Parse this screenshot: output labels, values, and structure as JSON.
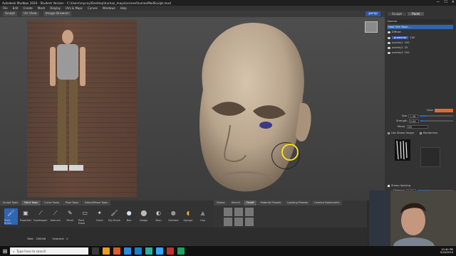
{
  "window": {
    "title": "Autodesk Mudbox 2020 - Student Version - C:\\Users\\mycoy\\Desktop\\human_maya\\scenes\\humanModSculpt.mud",
    "min": "—",
    "max": "☐",
    "close": "✕"
  },
  "menu": [
    "File",
    "Edit",
    "Create",
    "Mesh",
    "Display",
    "UVs & Maps",
    "Curves",
    "Windows",
    "Help"
  ],
  "toolbar": {
    "items": [
      "Sculpt",
      "UV View",
      "Image Browser"
    ],
    "camera": "persp"
  },
  "right_panel": {
    "tabs": [
      "Sculpt",
      "Paint"
    ],
    "dropdown": "Normal",
    "layers": [
      {
        "name": "Head Skin Base ...",
        "selected": true
      },
      {
        "name": "Diffuse",
        "selected": false
      },
      {
        "name": "gradiente",
        "value": "100",
        "selected": true
      },
      {
        "name": "overlay1",
        "value": "100",
        "selected": false
      },
      {
        "name": "overlay2",
        "value": "25",
        "selected": false
      },
      {
        "name": "overlay3",
        "value": "100",
        "selected": false
      }
    ],
    "props": {
      "color_label": "Color",
      "color_hex": "#e36b2a",
      "size_label": "Size",
      "size_value": "1.36",
      "size_fill": 0.2,
      "strength_label": "Strength",
      "strength_value": "0.06",
      "strength_fill": 0.1,
      "mirror_label": "Mirror",
      "mirror_value": "Off",
      "stamp_label": "Use Stamp Image",
      "randomize_label": "Randomize",
      "stamp_spacing_label": "Stamp Spacing",
      "distance_label": "Distance",
      "distance_value": "6.28"
    }
  },
  "trays": {
    "tabs": [
      "Sculpt Tools",
      "Paint Tools",
      "Curve Tools",
      "Pose Tools",
      "Select/Move Tools"
    ],
    "active_tab": "Paint Tools",
    "tools": [
      {
        "label": "Paint Brush",
        "icon": "paint-brush-icon",
        "glyph": "🖌"
      },
      {
        "label": "Projection",
        "icon": "projection-icon",
        "glyph": "▣"
      },
      {
        "label": "Eyedropper",
        "icon": "eyedropper-icon",
        "glyph": "⟋"
      },
      {
        "label": "Airbrush",
        "icon": "airbrush-icon",
        "glyph": "⟋"
      },
      {
        "label": "Pencil",
        "icon": "pencil-icon",
        "glyph": "✎"
      },
      {
        "label": "Paint Erase",
        "icon": "eraser-icon",
        "glyph": "▭"
      },
      {
        "label": "Clone",
        "icon": "clone-icon",
        "glyph": "✦"
      },
      {
        "label": "Dry Brush",
        "icon": "dry-brush-icon",
        "glyph": "🖌"
      },
      {
        "label": "Blur",
        "icon": "blur-icon",
        "glyph": "●"
      },
      {
        "label": "Dodge",
        "icon": "dodge-icon",
        "glyph": "⬤"
      },
      {
        "label": "Burn",
        "icon": "burn-icon",
        "glyph": "◐"
      },
      {
        "label": "Contrast",
        "icon": "contrast-icon",
        "glyph": "●"
      },
      {
        "label": "Sponge",
        "icon": "sponge-icon",
        "glyph": "◖"
      },
      {
        "label": "Hue",
        "icon": "hue-icon",
        "glyph": "▲"
      }
    ]
  },
  "stamps": {
    "tabs": [
      "Stamp",
      "Stencil",
      "Falloff",
      "Material Presets",
      "Lighting Presets",
      "Camera Bookmarks"
    ],
    "active_tab": "Falloff"
  },
  "status": {
    "total_label": "Total:",
    "total_value": "208046",
    "selected_label": "Selected:",
    "selected_value": "0"
  },
  "taskbar": {
    "search_placeholder": "Type here to search",
    "time": "10:40 PM",
    "date": "9/16/2020"
  }
}
